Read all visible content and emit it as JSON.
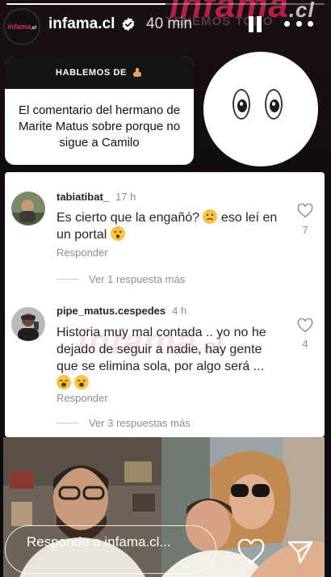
{
  "story": {
    "progress": 0.5,
    "background_brand": "infama",
    "background_brand_suffix": ".cl",
    "background_tag": "TENEMOS TODO"
  },
  "header": {
    "avatar_logo": "infama",
    "avatar_logo_suffix": ".cl",
    "account": "infama.cl",
    "time_ago": "40 min"
  },
  "question": {
    "header": "HABLEMOS DE",
    "header_icon": "pointing-down-hand-icon",
    "text": "El comentario del hermano de Marite Matus sobre porque no sigue a Camilo"
  },
  "eyes_sticker": "eyes-icon",
  "comments": [
    {
      "user": "tabiatibat_",
      "ago": "17 h",
      "text_before_emoji": "Es cierto que la engañó?",
      "emoji_1": "worried-face-icon",
      "text_after_emoji": "eso leí en un portal",
      "emoji_2": "surprised-face-icon",
      "reply": "Responder",
      "likes": "7",
      "more_replies": "Ver 1 respuesta más"
    },
    {
      "user": "pipe_matus.cespedes",
      "ago": "4 h",
      "text": "Historia muy mal contada .. yo no he dejado de seguir a nadie, hay gente que se elimina sola, por algo será ...",
      "emoji": "yawning-face-icon",
      "reply": "Responder",
      "likes": "4",
      "more_replies": "Ver 3 respuestas más"
    }
  ],
  "comments_watermark": "infama",
  "comments_watermark_suffix": ".cl",
  "footer": {
    "reply_placeholder": "Responde a infama.cl...",
    "like_icon": "heart-icon",
    "send_icon": "send-icon"
  },
  "colors": {
    "brand": "#e0245e",
    "card_header": "#141414",
    "text_primary": "#262626",
    "text_secondary": "#8e8e8e"
  }
}
